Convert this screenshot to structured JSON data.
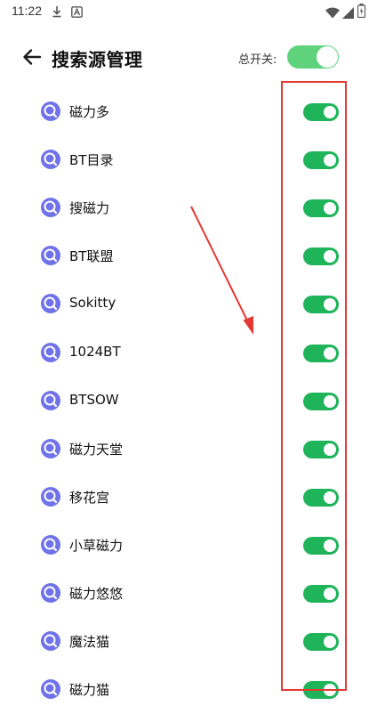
{
  "status_bar": {
    "time": "11:22",
    "icons": [
      "download-icon",
      "a-badge-icon",
      "wifi-icon",
      "signal-icon",
      "battery-icon"
    ]
  },
  "header": {
    "back_icon": "arrow-left-icon",
    "title": "搜索源管理",
    "master_toggle_label": "总开关:",
    "master_toggle_on": true
  },
  "sources": [
    {
      "label": "磁力多",
      "enabled": true
    },
    {
      "label": "BT目录",
      "enabled": true
    },
    {
      "label": "搜磁力",
      "enabled": true
    },
    {
      "label": "BT联盟",
      "enabled": true
    },
    {
      "label": "Sokitty",
      "enabled": true
    },
    {
      "label": "1024BT",
      "enabled": true
    },
    {
      "label": "BTSOW",
      "enabled": true
    },
    {
      "label": "磁力天堂",
      "enabled": true
    },
    {
      "label": "移花宫",
      "enabled": true
    },
    {
      "label": "小草磁力",
      "enabled": true
    },
    {
      "label": "磁力悠悠",
      "enabled": true
    },
    {
      "label": "魔法猫",
      "enabled": true
    },
    {
      "label": "磁力猫",
      "enabled": true
    }
  ],
  "colors": {
    "toggle_on": "#1fb45a",
    "master_toggle_on": "#5fd37b",
    "source_icon": "#6f72e8",
    "annotation": "#e53935"
  }
}
